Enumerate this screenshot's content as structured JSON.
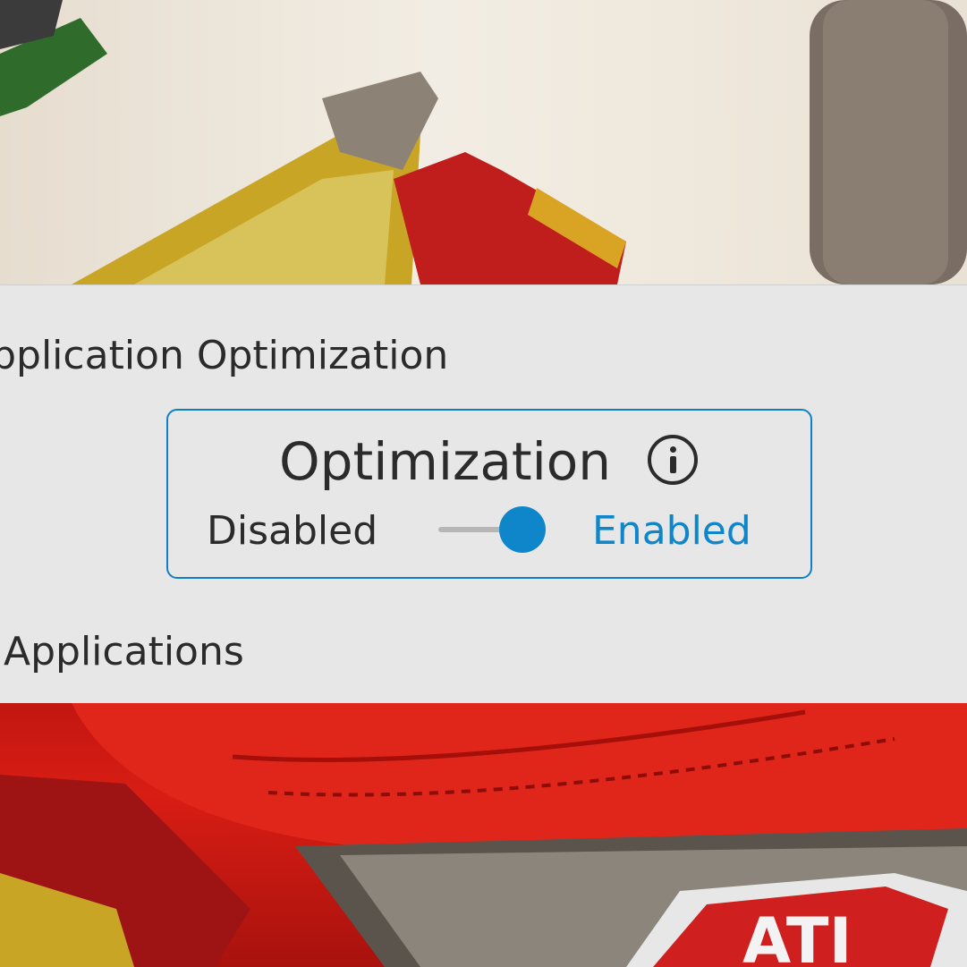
{
  "background": {
    "top_colors": [
      "#e6ddcf",
      "#f2ede4"
    ],
    "bottom_colors": [
      "#c21610",
      "#a8120d"
    ],
    "logo_text": "ATI"
  },
  "panel": {
    "section_title": "Application Optimization",
    "card": {
      "title": "Optimization",
      "info_icon": "info-circle-icon",
      "toggle": {
        "off_label": "Disabled",
        "on_label": "Enabled",
        "state": "enabled",
        "accent_color": "#0f86c9"
      }
    },
    "applications_title": "Applications"
  }
}
